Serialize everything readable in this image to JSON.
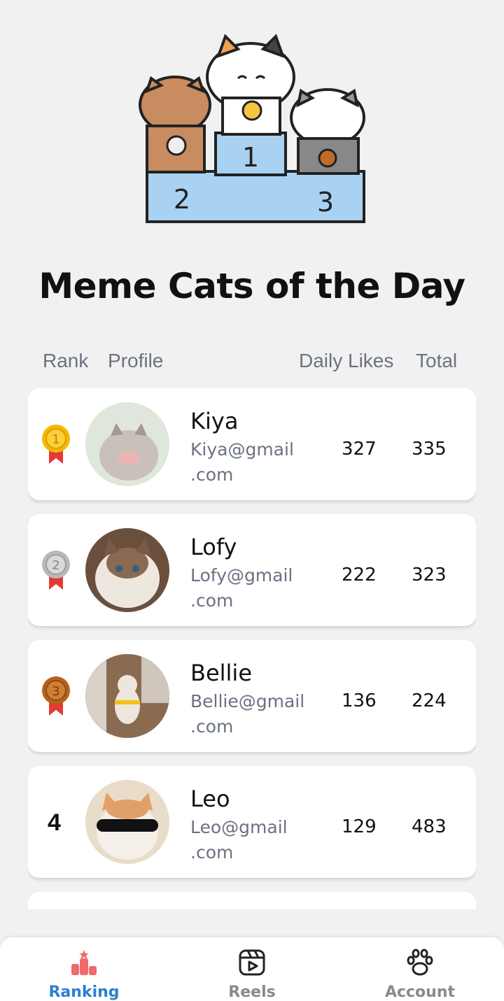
{
  "title": "Meme Cats of the Day",
  "columns": {
    "rank": "Rank",
    "profile": "Profile",
    "daily": "Daily Likes",
    "total": "Total"
  },
  "rows": [
    {
      "rank": "1",
      "medal": "gold",
      "name": "Kiya",
      "email_user": "Kiya@gmail",
      "email_domain": ".com",
      "daily": "327",
      "total": "335"
    },
    {
      "rank": "2",
      "medal": "silver",
      "name": "Lofy",
      "email_user": "Lofy@gmail",
      "email_domain": ".com",
      "daily": "222",
      "total": "323"
    },
    {
      "rank": "3",
      "medal": "bronze",
      "name": "Bellie",
      "email_user": "Bellie@gmail",
      "email_domain": ".com",
      "daily": "136",
      "total": "224"
    },
    {
      "rank": "4",
      "medal": "",
      "name": "Leo",
      "email_user": "Leo@gmail",
      "email_domain": ".com",
      "daily": "129",
      "total": "483"
    }
  ],
  "nav": {
    "ranking": "Ranking",
    "reels": "Reels",
    "account": "Account"
  },
  "colors": {
    "accent": "#2b7fd1",
    "rank_icon": "#f06a6a",
    "gold": "#f5b800",
    "silver": "#c3c3c3",
    "bronze": "#c06b2a",
    "ribbon": "#e53935",
    "podium": "#a9d2f2"
  },
  "icons": {
    "ranking": "podium-icon",
    "reels": "reels-icon",
    "account": "paw-icon"
  }
}
